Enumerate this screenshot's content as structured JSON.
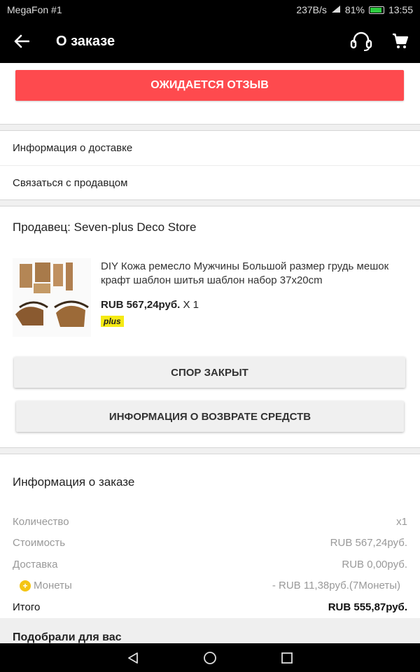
{
  "status_bar": {
    "carrier": "MegaFon #1",
    "speed": "237B/s",
    "battery": "81%",
    "time": "13:55"
  },
  "header": {
    "title": "О заказе",
    "back_icon": "arrow-left-icon",
    "support_icon": "headset-icon",
    "cart_icon": "cart-icon"
  },
  "review": {
    "button_label": "ОЖИДАЕТСЯ ОТЗЫВ",
    "color": "#fe4a4e"
  },
  "links": [
    {
      "label": "Информация о доставке"
    },
    {
      "label": "Связаться с продавцом"
    }
  ],
  "seller": {
    "name": "Продавец: Seven-plus Deco Store",
    "product": {
      "title": "DIY Кожа ремесло Мужчины Большой размер грудь мешок крафт шаблон шитья шаблон набор 37x20cm",
      "price": "RUB 567,24руб.",
      "quantity": "X 1",
      "badge": "plus"
    },
    "dispute_button": "СПОР ЗАКРЫТ",
    "refund_button": "ИНФОРМАЦИЯ О ВОЗВРАТЕ СРЕДСТВ"
  },
  "order": {
    "title": "Информация о заказе",
    "rows": [
      {
        "label": "Количество",
        "value": "x1"
      },
      {
        "label": "Стоимость",
        "value": "RUB 567,24руб."
      },
      {
        "label": "Доставка",
        "value": "RUB 0,00руб."
      },
      {
        "label": "Монеты",
        "value": "- RUB 11,38руб.(7Монеты)"
      }
    ],
    "total": {
      "label": "Итого",
      "value": "RUB 555,87руб."
    }
  },
  "recommend_title": "Подобрали для вас"
}
